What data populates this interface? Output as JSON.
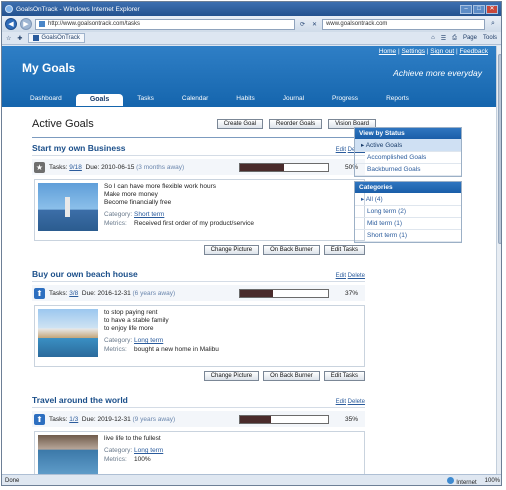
{
  "browser": {
    "window_title": "GoalsOnTrack - Windows Internet Explorer",
    "address": "http://www.goalsontrack.com/tasks",
    "search_text": "www.goalsontrack.com",
    "tab_title": "GoalsOnTrack",
    "page_menu": "Page",
    "tools_menu": "Tools",
    "status_left": "Done",
    "status_zone": "Internet",
    "zoom": "100%"
  },
  "site": {
    "title": "My Goals",
    "tagline": "Achieve more everyday",
    "toplinks": [
      "Home",
      "Settings",
      "Sign out",
      "Feedback"
    ],
    "nav": [
      "Dashboard",
      "Goals",
      "Tasks",
      "Calendar",
      "Habits",
      "Journal",
      "Progress",
      "Reports"
    ]
  },
  "page": {
    "heading": "Active Goals",
    "buttons": {
      "create": "Create Goal",
      "reorder": "Reorder Goals",
      "vision": "Vision Board"
    }
  },
  "labels": {
    "edit": "Edit",
    "delete": "Delete",
    "tasks": "Tasks:",
    "due": "Due:",
    "category": "Category:",
    "metrics": "Metrics:",
    "change_picture": "Change Picture",
    "back_burner": "On Back Burner",
    "edit_tasks": "Edit Tasks"
  },
  "goals": [
    {
      "title": "Start my own Business",
      "tasks": "9/18",
      "due": "2010-06-15",
      "away": "(3 months away)",
      "progress_pct": 50,
      "progress_label": "50%",
      "reasons": [
        "So I can have more flexible work hours",
        "Make more money",
        "Become financially free"
      ],
      "category": "Short term",
      "metrics": "Received first order of my product/service"
    },
    {
      "title": "Buy our own beach house",
      "tasks": "3/8",
      "due": "2016-12-31",
      "away": "(6 years away)",
      "progress_pct": 37,
      "progress_label": "37%",
      "reasons": [
        "to stop paying rent",
        "to have a stable family",
        "to enjoy life more"
      ],
      "category": "Long term",
      "metrics": "bought a new home in Malibu"
    },
    {
      "title": "Travel around the world",
      "tasks": "1/3",
      "due": "2019-12-31",
      "away": "(9 years away)",
      "progress_pct": 35,
      "progress_label": "35%",
      "reasons": [
        "live life to the fullest"
      ],
      "category": "Long term",
      "metrics": "100%"
    }
  ],
  "sidebar": {
    "status_title": "View by Status",
    "status_items": [
      "Active Goals",
      "Accomplished Goals",
      "Backburned Goals"
    ],
    "categories_title": "Categories",
    "category_items": [
      "All (4)",
      "Long term (2)",
      "Mid term (1)",
      "Short term (1)"
    ]
  }
}
